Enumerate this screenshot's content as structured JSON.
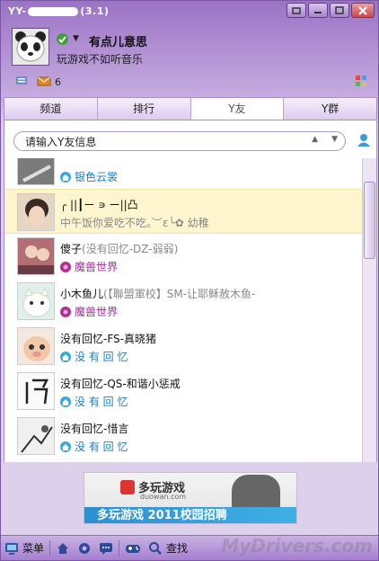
{
  "window": {
    "title_prefix": "YY-",
    "title_suffix": "(3.1)"
  },
  "profile": {
    "nickname": "有点儿意思",
    "signature": "玩游戏不如听音乐",
    "count": "6"
  },
  "tabs": [
    {
      "label": "频道"
    },
    {
      "label": "排行"
    },
    {
      "label": "Y友"
    },
    {
      "label": "Y群"
    }
  ],
  "search": {
    "placeholder": "请输入Y友信息"
  },
  "friends": [
    {
      "name": "",
      "status": "银色云裳",
      "status_color": "#1b7fc4",
      "game_icon": "home-icon"
    },
    {
      "name": "╭ ||┃ー  ∍  ー||凸",
      "status": "中午饭你爱吃不吃。︶ε╰✿ 幼稚",
      "status_color": "#888888",
      "game_icon": ""
    },
    {
      "name": "傻子",
      "note": "(没有回忆-DZ-弱弱)",
      "status": "魔兽世界",
      "status_color": "#9b2f9b",
      "game_icon": "wow-icon"
    },
    {
      "name": "小木鱼儿",
      "note": "(【聯盟軍校】SM-让耶稣赦木鱼-",
      "status": "魔兽世界",
      "status_color": "#9b2f9b",
      "game_icon": "wow-icon"
    },
    {
      "name": "没有回忆-FS-真晓猪",
      "status": "没 有 回 忆",
      "status_color": "#1b7fc4",
      "game_icon": "home-icon"
    },
    {
      "name": "没有回忆-QS-和谐小惩戒",
      "status": "没 有 回 忆",
      "status_color": "#1b7fc4",
      "game_icon": "home-icon"
    },
    {
      "name": "没有回忆-惜言",
      "status": "没 有 回 忆",
      "status_color": "#1b7fc4",
      "game_icon": "home-icon"
    }
  ],
  "ad": {
    "brand": "多玩游戏",
    "site": "duowan.com",
    "banner": "多玩游戏 2011校园招聘"
  },
  "bottombar": {
    "menu_label": "菜单",
    "find_label": "查找"
  },
  "watermark": "MyDrivers.com",
  "colors": {
    "accent": "#9b73c6",
    "selected_row": "#fff6d0"
  }
}
